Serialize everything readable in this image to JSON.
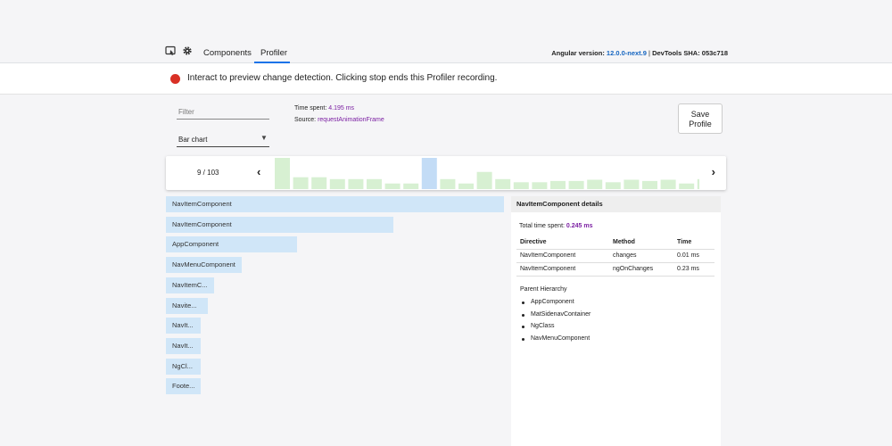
{
  "toolbar": {
    "tabs": [
      {
        "label": "Components",
        "active": false
      },
      {
        "label": "Profiler",
        "active": true
      }
    ],
    "icons": [
      "inspect-element-icon",
      "gear-icon"
    ],
    "version_label": "Angular version:",
    "version_value": "12.0.0-next.9",
    "separator": "|",
    "sha_label": "DevTools SHA:",
    "sha_value": "053c718"
  },
  "banner": {
    "text": "Interact to preview change detection. Clicking stop ends this Profiler recording.",
    "record_color": "#d93025"
  },
  "controls": {
    "filter_placeholder": "Filter",
    "view_select": "Bar chart",
    "time_spent_label": "Time spent:",
    "time_spent_value": "4.195 ms",
    "source_label": "Source:",
    "source_value": "requestAnimationFrame",
    "save_button": [
      "Save",
      "Profile"
    ]
  },
  "frames": {
    "counter": "9 / 103",
    "selected_index": 8,
    "bar_values": [
      1.0,
      0.38,
      0.38,
      0.32,
      0.32,
      0.32,
      0.18,
      0.18,
      1.0,
      0.32,
      0.18,
      0.55,
      0.32,
      0.22,
      0.22,
      0.26,
      0.26,
      0.3,
      0.22,
      0.3,
      0.26,
      0.3,
      0.18,
      0.32,
      0.18,
      0.22
    ]
  },
  "flame_chart": {
    "bars": [
      {
        "label": "NavItemComponent",
        "value": 1.0
      },
      {
        "label": "NavItemComponent",
        "value": 0.672
      },
      {
        "label": "AppComponent",
        "value": 0.388
      },
      {
        "label": "NavMenuComponent",
        "value": 0.223
      },
      {
        "label": "NavItemC...",
        "value": 0.142
      },
      {
        "label": "Navite...",
        "value": 0.124
      },
      {
        "label": "NavIt...",
        "value": 0.103
      },
      {
        "label": "NavIt...",
        "value": 0.103
      },
      {
        "label": "NgCl...",
        "value": 0.103
      },
      {
        "label": "Foote...",
        "value": 0.103
      }
    ],
    "bar_color": "#d0e6f8"
  },
  "details": {
    "title": "NavItemComponent details",
    "total_time_label": "Total time spent:",
    "total_time_value": "0.245 ms",
    "columns": [
      "Directive",
      "Method",
      "Time"
    ],
    "rows": [
      [
        "NavItemComponent",
        "changes",
        "0.01 ms"
      ],
      [
        "NavItemComponent",
        "ngOnChanges",
        "0.23 ms"
      ]
    ],
    "parent_title": "Parent Hierarchy",
    "parents": [
      "AppComponent",
      "MatSidenavContainer",
      "NgClass",
      "NavMenuComponent"
    ]
  },
  "colors": {
    "accent": "#1a73e8",
    "value_purple": "#7b1fa2",
    "frame_bar": "#d7f0d2",
    "frame_selected": "#c3dcf6"
  }
}
